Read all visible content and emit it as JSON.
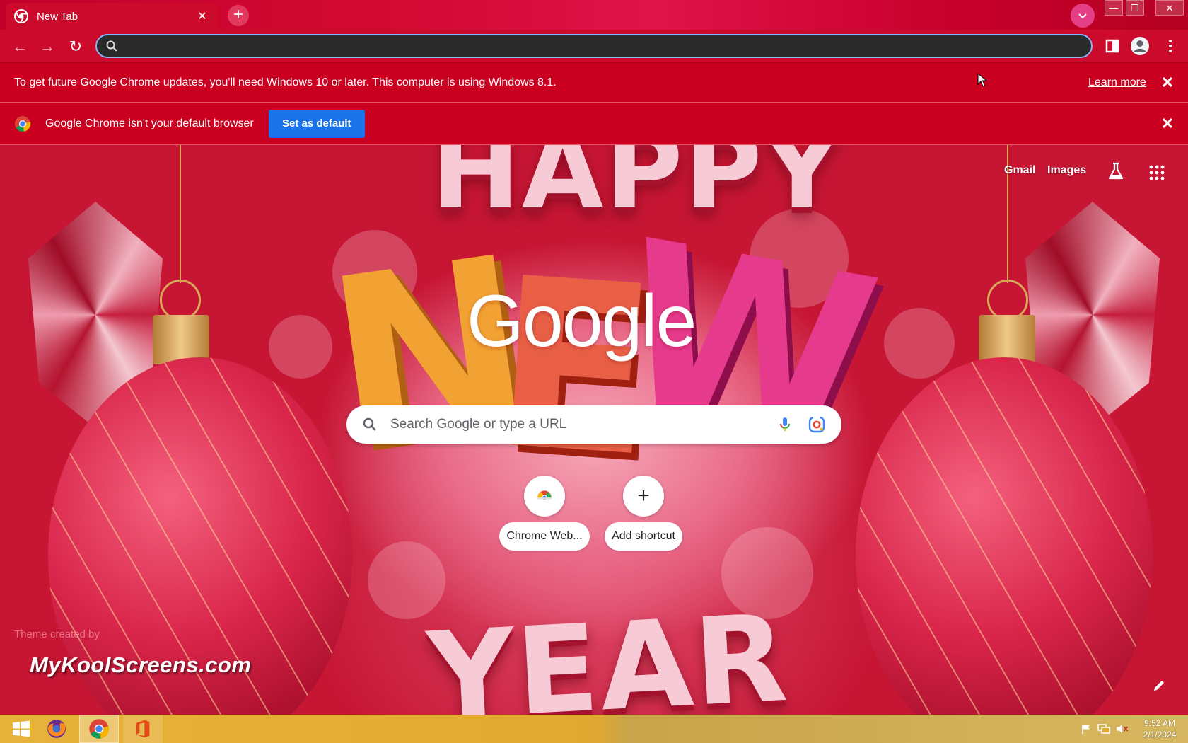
{
  "browser": {
    "tab": {
      "title": "New Tab",
      "close_glyph": "✕"
    },
    "new_tab_glyph": "+",
    "tab_search_glyph": "⌄",
    "window_controls": {
      "minimize": "—",
      "maximize": "❐",
      "close": "✕"
    },
    "nav": {
      "back": "←",
      "forward": "→",
      "reload": "↻"
    },
    "omnibox": {
      "value": "",
      "placeholder": ""
    }
  },
  "infobars": {
    "update_message": "To get future Google Chrome updates, you'll need Windows 10 or later. This computer is using Windows 8.1.",
    "learn_more": "Learn more",
    "default_browser_message": "Google Chrome isn't your default browser",
    "set_default_label": "Set as default",
    "close_glyph": "✕"
  },
  "ntp": {
    "links": {
      "gmail": "Gmail",
      "images": "Images"
    },
    "logo_text": "Google",
    "search_placeholder": "Search Google or type a URL",
    "shortcuts": [
      {
        "label": "Chrome Web...",
        "icon": "chrome-web-store-icon"
      },
      {
        "label": "Add shortcut",
        "icon": "plus-icon"
      }
    ],
    "plus_glyph": "+",
    "theme_credit": "Theme created by",
    "theme_brand": "MyKoolScreens.com",
    "theme_art": {
      "word_top": "HAPPY",
      "word_middle": [
        "N",
        "E",
        "W"
      ],
      "word_bottom": "YEAR"
    }
  },
  "taskbar": {
    "apps": [
      "start-icon",
      "firefox-icon",
      "chrome-icon",
      "office-icon"
    ],
    "clock_time": "9:52 AM",
    "clock_date": "2/1/2024"
  },
  "colors": {
    "chrome_red": "#cc0a2c",
    "infobar_red": "#c90020",
    "set_default_blue": "#1a73e8",
    "focus_ring": "#8ab4f8",
    "taskbar_gold": "#e2a932"
  }
}
